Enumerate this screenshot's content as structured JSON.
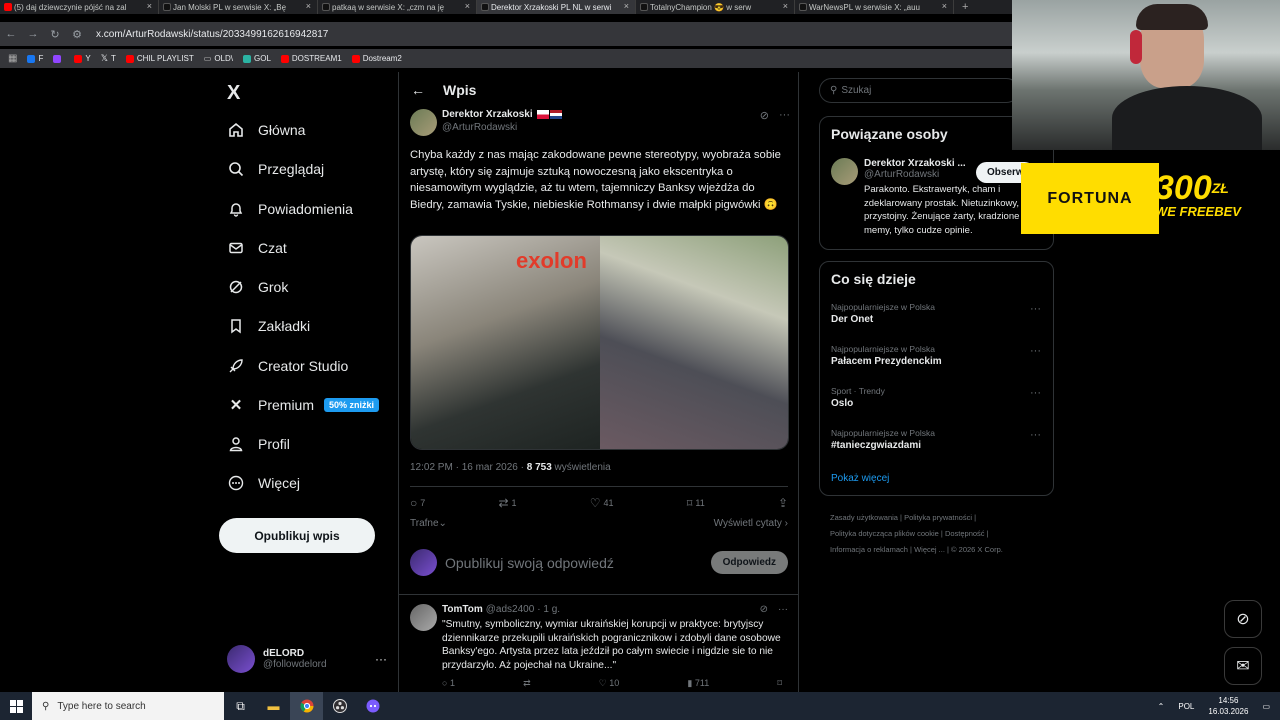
{
  "browser": {
    "tabs": [
      {
        "label": "(5) daj dziewczynie pójść na zal",
        "active": false
      },
      {
        "label": "Jan Molski PL w serwisie X: „Bę",
        "active": false
      },
      {
        "label": "patkaą w serwisie X: „czm na ję",
        "active": false
      },
      {
        "label": "Derektor Xrzakoski PL NL w serwi",
        "active": true
      },
      {
        "label": "TotalnyChampion 😎 w serw",
        "active": false
      },
      {
        "label": "WarNewsPL w serwisie X: „auu",
        "active": false
      }
    ],
    "url": "x.com/ArturRodawski/status/2033499162616942817",
    "bookmarks": [
      "F",
      "",
      "Y",
      "T",
      "CHIL PLAYLIST",
      "OLD\\",
      "GOL",
      "DOSTREAM1",
      "Dostream2"
    ]
  },
  "sidebar": {
    "logo": "X",
    "items": [
      {
        "label": "Główna",
        "icon": "home-icon"
      },
      {
        "label": "Przeglądaj",
        "icon": "search-icon"
      },
      {
        "label": "Powiadomienia",
        "icon": "bell-icon"
      },
      {
        "label": "Czat",
        "icon": "mail-icon"
      },
      {
        "label": "Grok",
        "icon": "grok-icon"
      },
      {
        "label": "Zakładki",
        "icon": "bookmark-icon"
      },
      {
        "label": "Creator Studio",
        "icon": "rocket-icon"
      },
      {
        "label": "Premium",
        "icon": "x-icon"
      },
      {
        "label": "Profil",
        "icon": "person-icon"
      },
      {
        "label": "Więcej",
        "icon": "more-circle-icon"
      }
    ],
    "premium_badge": "50% zniżki",
    "publish_label": "Opublikuj wpis",
    "account": {
      "name": "dELORD",
      "handle": "@followdelord"
    }
  },
  "post": {
    "header": "Wpis",
    "author": {
      "name": "Derektor Xrzakoski",
      "handle": "@ArturRodawski"
    },
    "text": "Chyba każdy z nas mając zakodowane pewne stereotypy, wyobraża sobie artystę, który się zajmuje sztuką nowoczesną jako ekscentryka o niesamowitym wyglądzie, aż tu wtem, tajemniczy Banksy wjeżdża do Biedry, zamawia Tyskie, niebieskie Rothmansy i dwie małpki pigwówki 🙃",
    "time": "12:02 PM · 16 mar 2026 · ",
    "views": "8 753",
    "views_label": " wyświetlenia",
    "stats": {
      "replies": "7",
      "reposts": "1",
      "likes": "41",
      "bookmarks": "11"
    },
    "sort_label": "Trafne",
    "quotes_label": "Wyświetl cytaty",
    "reply_placeholder": "Opublikuj swoją odpowiedź",
    "reply_button": "Odpowiedz"
  },
  "reply": {
    "name": "TomTom",
    "handle": "@ads2400",
    "age": "· 1 g.",
    "text": "\"Smutny, symboliczny, wymiar ukraińskiej korupcji w praktyce: brytyjscy dziennikarze przekupili ukraińskich pogranicznikow i zdobyli dane osobowe Banksy'ego. Artysta przez lata jeździł po całym swiecie i nigdzie sie to nie przydarzyło. Aż pojechał na Ukraine...\"",
    "stats": {
      "replies": "1",
      "likes": "10",
      "views": "711"
    }
  },
  "right": {
    "search_placeholder": "Szukaj",
    "related_title": "Powiązane osoby",
    "related": {
      "name": "Derektor Xrzakoski ...",
      "handle": "@ArturRodawski",
      "follow": "Obserw",
      "bio": "Parakonto. Ekstrawertyk, cham i zdeklarowany prostak. Nietuzinkowy, przystojny. Żenujące żarty, kradzione memy, tylko cudze opinie."
    },
    "trends_title": "Co się dzieje",
    "trends": [
      {
        "meta": "Najpopularniejsze w Polska",
        "name": "Der Onet"
      },
      {
        "meta": "Najpopularniejsze w Polska",
        "name": "Pałacem Prezydenckim"
      },
      {
        "meta": "Sport · Trendy",
        "name": "Oslo"
      },
      {
        "meta": "Najpopularniejsze w Polska",
        "name": "#tanieczgwiazdami"
      }
    ],
    "show_more": "Pokaż więcej",
    "footer": [
      "Zasady użytkowania",
      "Polityka prywatności",
      "Polityka dotycząca plików cookie",
      "Dostępność",
      "Informacja o reklamach",
      "Więcej ...",
      "© 2026 X Corp."
    ]
  },
  "overlay": {
    "ad_brand": "FORTUNA",
    "ad_amount": "300",
    "ad_currency": "ZŁ",
    "ad_tag": "WE FREEBEV"
  },
  "taskbar": {
    "search_placeholder": "Type here to search",
    "lang": "POL",
    "time": "14:56",
    "date": "16.03.2026"
  },
  "colors": {
    "accent": "#1d9bf0",
    "background": "#000000",
    "border": "#2f3336",
    "muted": "#71767b",
    "ad_yellow": "#ffdd00"
  }
}
